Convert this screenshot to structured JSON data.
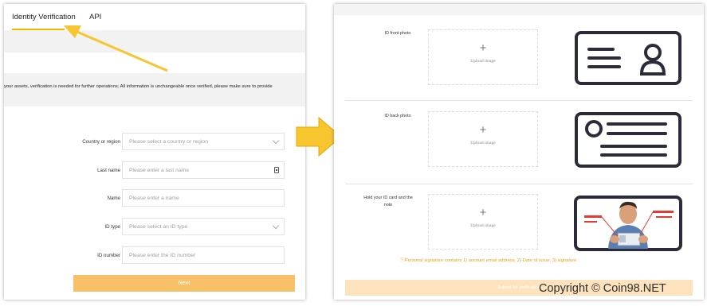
{
  "tabs": {
    "active": "Identity Verification",
    "other": "API"
  },
  "notice": "your assets, verification is needed for further operations; All information is unchangeable once verified, please make sure to provide",
  "form": {
    "country": {
      "label": "Country or region",
      "placeholder": "Please select a country or region"
    },
    "last_name": {
      "label": "Last name",
      "placeholder": "Please enter a last name"
    },
    "name": {
      "label": "Name",
      "placeholder": "Please enter a name"
    },
    "id_type": {
      "label": "ID type",
      "placeholder": "Please select an ID type"
    },
    "id_number": {
      "label": "ID number",
      "placeholder": "Please enter the ID number"
    },
    "next_label": "Next"
  },
  "uploads": {
    "front_label": "ID front photo",
    "back_label": "ID back photo",
    "hold_label_line1": "Hold your ID card and the",
    "hold_label_line2": "note",
    "upload_text": "Upload image",
    "plus": "+"
  },
  "note": "ⓘPersonal signature contains 1) account email address, 2) Date of issue, 3) signature",
  "submit_label": "Submit for verification",
  "copyright": "Copyright © Coin98.NET",
  "colors": {
    "accent": "#f7b500",
    "button": "#f9c167",
    "arrow": "#f7c52e",
    "id_icon": "#2b2b3a"
  }
}
